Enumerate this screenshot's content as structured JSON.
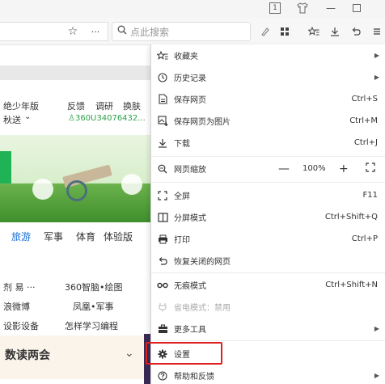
{
  "titlebar": {
    "badge_label": "1",
    "shirt_icon": "shirt-icon",
    "minimize_label": "—",
    "maximize_icon": "maximize-icon"
  },
  "toolbar": {
    "star_icon": "☆",
    "more_icon": "···",
    "search_placeholder": "点此搜索",
    "icons": [
      "brush-icon",
      "grid-icon",
      "favorites-icon",
      "download-icon",
      "undo-icon",
      "menu-icon"
    ]
  },
  "page": {
    "row1_left_top": "绝少年版",
    "row1_left_bottom": "秋送",
    "row1_feedback": "反馈",
    "row1_survey": "调研",
    "row1_switch": "换肤",
    "row1_user_id": "360U34076432...",
    "nav_items": [
      "旅游",
      "军事",
      "体育",
      "体验版"
    ],
    "links_left": [
      "剂 易 ···",
      "浪微博",
      "设影设备"
    ],
    "links_right": [
      "360智脑•绘图",
      "凤凰•军事",
      "怎样学习编程"
    ],
    "banner_title": "数读两会"
  },
  "menu": {
    "items": [
      {
        "label": "收藏夹",
        "shortcut": "",
        "has_arrow": true,
        "icon": "favorites-icon"
      },
      {
        "label": "历史记录",
        "shortcut": "",
        "has_arrow": true,
        "icon": "history-icon"
      },
      {
        "label": "保存网页",
        "shortcut": "Ctrl+S",
        "has_arrow": false,
        "icon": "save-page-icon"
      },
      {
        "label": "保存网页为图片",
        "shortcut": "Ctrl+M",
        "has_arrow": false,
        "icon": "save-image-icon"
      },
      {
        "label": "下载",
        "shortcut": "Ctrl+J",
        "has_arrow": false,
        "icon": "download-icon"
      },
      {
        "label": "网页缩放",
        "zoom_minus": "—",
        "zoom_value": "100%",
        "zoom_plus": "+",
        "icon": "zoom-icon"
      },
      {
        "label": "全屏",
        "shortcut": "F11",
        "has_arrow": false,
        "icon": "fullscreen-icon"
      },
      {
        "label": "分屏模式",
        "shortcut": "Ctrl+Shift+Q",
        "has_arrow": false,
        "icon": "split-screen-icon"
      },
      {
        "label": "打印",
        "shortcut": "Ctrl+P",
        "has_arrow": false,
        "icon": "print-icon"
      },
      {
        "label": "恢复关闭的网页",
        "shortcut": "",
        "has_arrow": false,
        "icon": "restore-tab-icon"
      },
      {
        "label": "无痕模式",
        "shortcut": "Ctrl+Shift+N",
        "has_arrow": false,
        "icon": "incognito-icon"
      },
      {
        "label": "省电模式：禁用",
        "shortcut": "",
        "has_arrow": false,
        "icon": "power-save-icon",
        "disabled": true
      },
      {
        "label": "更多工具",
        "shortcut": "",
        "has_arrow": true,
        "icon": "toolbox-icon"
      },
      {
        "label": "设置",
        "shortcut": "",
        "has_arrow": false,
        "icon": "settings-icon",
        "highlighted": true
      },
      {
        "label": "帮助和反馈",
        "shortcut": "",
        "has_arrow": true,
        "icon": "help-icon"
      }
    ]
  },
  "colors": {
    "highlight_border": "#e02020",
    "green_text": "#2aa14a"
  }
}
